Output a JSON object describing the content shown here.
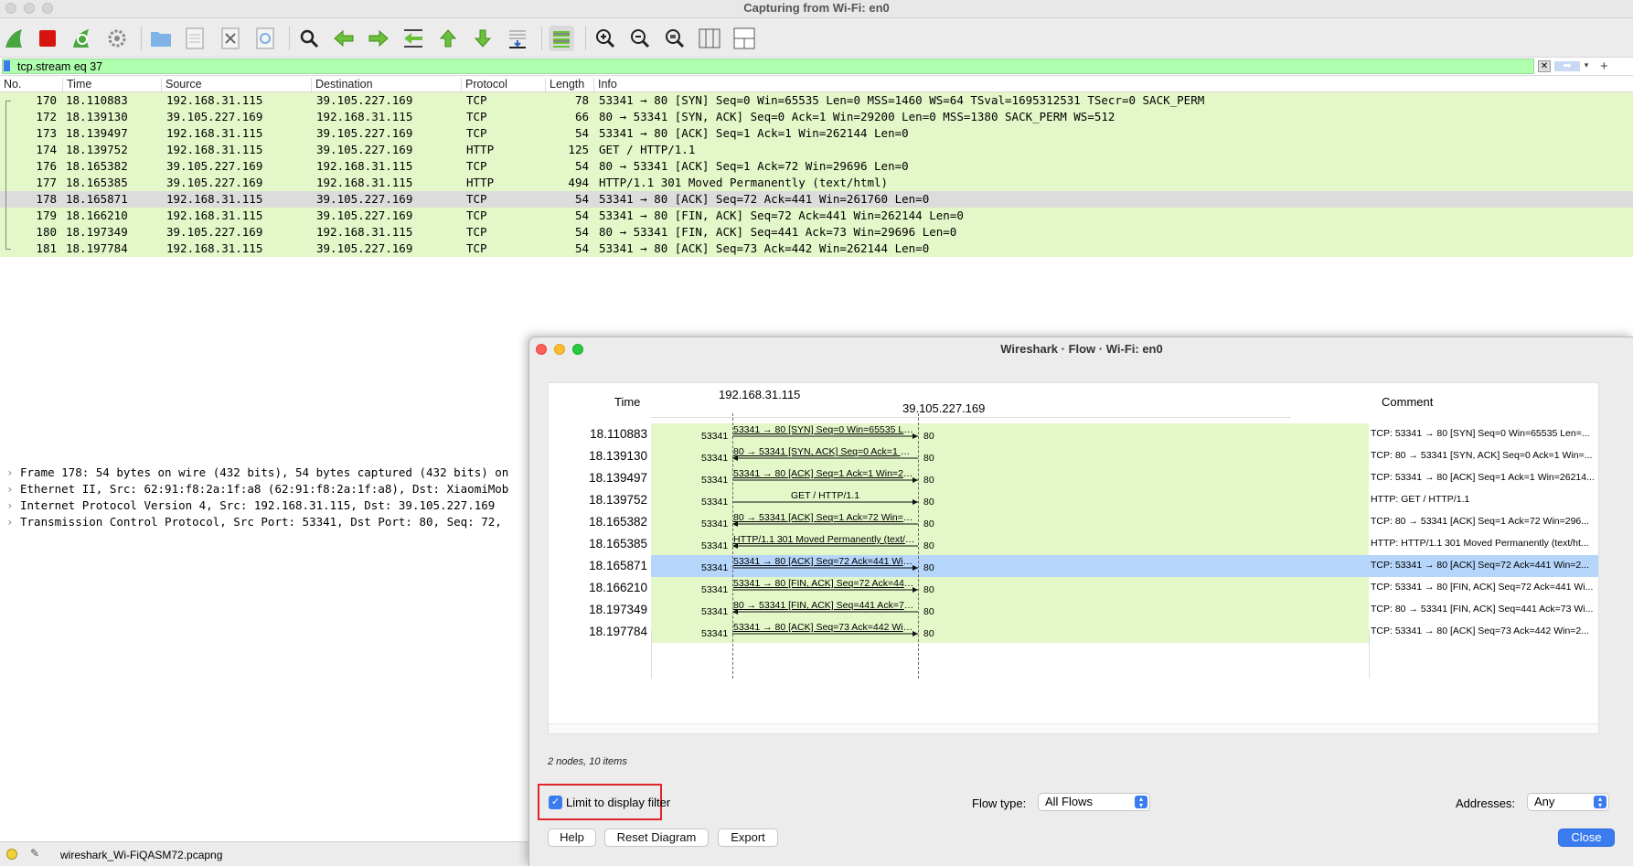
{
  "main_window": {
    "title": "Capturing from Wi-Fi: en0",
    "toolbar": [
      "shark-fin-icon",
      "stop-icon",
      "restart-icon",
      "gear-icon",
      "open-folder-icon",
      "save-file-icon",
      "close-file-icon",
      "reload-icon",
      "search-icon",
      "back-arrow-icon",
      "forward-arrow-icon",
      "goto-packet-icon",
      "first-packet-icon",
      "last-packet-icon",
      "autoscroll-icon",
      "colorize-icon",
      "zoom-in-icon",
      "zoom-out-icon",
      "zoom-reset-icon",
      "resize-columns-icon",
      "layout-icon"
    ],
    "filter": {
      "value": "tcp.stream eq 37",
      "add_label": "+"
    },
    "columns": [
      "No.",
      "Time",
      "Source",
      "Destination",
      "Protocol",
      "Length",
      "Info"
    ],
    "packets": [
      {
        "no": "170",
        "time": "18.110883",
        "src": "192.168.31.115",
        "dst": "39.105.227.169",
        "proto": "TCP",
        "len": "78",
        "info": "53341 → 80 [SYN] Seq=0 Win=65535 Len=0 MSS=1460 WS=64 TSval=1695312531 TSecr=0 SACK_PERM"
      },
      {
        "no": "172",
        "time": "18.139130",
        "src": "39.105.227.169",
        "dst": "192.168.31.115",
        "proto": "TCP",
        "len": "66",
        "info": "80 → 53341 [SYN, ACK] Seq=0 Ack=1 Win=29200 Len=0 MSS=1380 SACK_PERM WS=512"
      },
      {
        "no": "173",
        "time": "18.139497",
        "src": "192.168.31.115",
        "dst": "39.105.227.169",
        "proto": "TCP",
        "len": "54",
        "info": "53341 → 80 [ACK] Seq=1 Ack=1 Win=262144 Len=0"
      },
      {
        "no": "174",
        "time": "18.139752",
        "src": "192.168.31.115",
        "dst": "39.105.227.169",
        "proto": "HTTP",
        "len": "125",
        "info": "GET / HTTP/1.1"
      },
      {
        "no": "176",
        "time": "18.165382",
        "src": "39.105.227.169",
        "dst": "192.168.31.115",
        "proto": "TCP",
        "len": "54",
        "info": "80 → 53341 [ACK] Seq=1 Ack=72 Win=29696 Len=0"
      },
      {
        "no": "177",
        "time": "18.165385",
        "src": "39.105.227.169",
        "dst": "192.168.31.115",
        "proto": "HTTP",
        "len": "494",
        "info": "HTTP/1.1 301 Moved Permanently  (text/html)"
      },
      {
        "no": "178",
        "time": "18.165871",
        "src": "192.168.31.115",
        "dst": "39.105.227.169",
        "proto": "TCP",
        "len": "54",
        "info": "53341 → 80 [ACK] Seq=72 Ack=441 Win=261760 Len=0"
      },
      {
        "no": "179",
        "time": "18.166210",
        "src": "192.168.31.115",
        "dst": "39.105.227.169",
        "proto": "TCP",
        "len": "54",
        "info": "53341 → 80 [FIN, ACK] Seq=72 Ack=441 Win=262144 Len=0"
      },
      {
        "no": "180",
        "time": "18.197349",
        "src": "39.105.227.169",
        "dst": "192.168.31.115",
        "proto": "TCP",
        "len": "54",
        "info": "80 → 53341 [FIN, ACK] Seq=441 Ack=73 Win=29696 Len=0"
      },
      {
        "no": "181",
        "time": "18.197784",
        "src": "192.168.31.115",
        "dst": "39.105.227.169",
        "proto": "TCP",
        "len": "54",
        "info": "53341 → 80 [ACK] Seq=73 Ack=442 Win=262144 Len=0"
      }
    ],
    "selected_packet": "178",
    "details": [
      "Frame 178: 54 bytes on wire (432 bits), 54 bytes captured (432 bits) on",
      "Ethernet II, Src: 62:91:f8:2a:1f:a8 (62:91:f8:2a:1f:a8), Dst: XiaomiMob",
      "Internet Protocol Version 4, Src: 192.168.31.115, Dst: 39.105.227.169",
      "Transmission Control Protocol, Src Port: 53341, Dst Port: 80, Seq: 72,"
    ],
    "status_file": "wireshark_Wi-FiQASM72.pcapng"
  },
  "flow_dialog": {
    "title": "Wireshark · Flow · Wi-Fi: en0",
    "col_time": "Time",
    "col_comment": "Comment",
    "node_a": "192.168.31.115",
    "node_b": "39.105.227.169",
    "items": [
      {
        "time": "18.110883",
        "label": "53341 → 80 [SYN] Seq=0 Win=65535 Len=0...",
        "dir": "right",
        "src_port": "53341",
        "dst_port": "80",
        "comment": "TCP: 53341 → 80 [SYN] Seq=0 Win=65535 Len=..."
      },
      {
        "time": "18.139130",
        "label": "80 → 53341 [SYN, ACK] Seq=0 Ack=1 Win=2...",
        "dir": "left",
        "src_port": "53341",
        "dst_port": "80",
        "comment": "TCP: 80 → 53341 [SYN, ACK] Seq=0 Ack=1 Win=..."
      },
      {
        "time": "18.139497",
        "label": "53341 → 80 [ACK] Seq=1 Ack=1 Win=262144...",
        "dir": "right",
        "src_port": "53341",
        "dst_port": "80",
        "comment": "TCP: 53341 → 80 [ACK] Seq=1 Ack=1 Win=26214..."
      },
      {
        "time": "18.139752",
        "label": "GET / HTTP/1.1",
        "dir": "right",
        "src_port": "53341",
        "dst_port": "80",
        "comment": "HTTP: GET / HTTP/1.1"
      },
      {
        "time": "18.165382",
        "label": "80 → 53341 [ACK] Seq=1 Ack=72 Win=2969...",
        "dir": "left",
        "src_port": "53341",
        "dst_port": "80",
        "comment": "TCP: 80 → 53341 [ACK] Seq=1 Ack=72 Win=296..."
      },
      {
        "time": "18.165385",
        "label": "HTTP/1.1 301 Moved Permanently  (text/html)",
        "dir": "left",
        "src_port": "53341",
        "dst_port": "80",
        "comment": "HTTP: HTTP/1.1 301 Moved Permanently  (text/ht..."
      },
      {
        "time": "18.165871",
        "label": "53341 → 80 [ACK] Seq=72 Ack=441 Win=26...",
        "dir": "right",
        "src_port": "53341",
        "dst_port": "80",
        "comment": "TCP: 53341 → 80 [ACK] Seq=72 Ack=441 Win=2..."
      },
      {
        "time": "18.166210",
        "label": "53341 → 80 [FIN, ACK] Seq=72 Ack=441 Win...",
        "dir": "right",
        "src_port": "53341",
        "dst_port": "80",
        "comment": "TCP: 53341 → 80 [FIN, ACK] Seq=72 Ack=441 Wi..."
      },
      {
        "time": "18.197349",
        "label": "80 → 53341 [FIN, ACK] Seq=441 Ack=73 Win...",
        "dir": "left",
        "src_port": "53341",
        "dst_port": "80",
        "comment": "TCP: 80 → 53341 [FIN, ACK] Seq=441 Ack=73 Wi..."
      },
      {
        "time": "18.197784",
        "label": "53341 → 80 [ACK] Seq=73 Ack=442 Win=26...",
        "dir": "right",
        "src_port": "53341",
        "dst_port": "80",
        "comment": "TCP: 53341 → 80 [ACK] Seq=73 Ack=442 Win=2..."
      }
    ],
    "selected_index": 6,
    "summary": "2 nodes, 10 items",
    "limit_label": "Limit to display filter",
    "limit_checked": true,
    "flow_type_label": "Flow type:",
    "flow_type_value": "All Flows",
    "addresses_label": "Addresses:",
    "addresses_value": "Any",
    "buttons": {
      "help": "Help",
      "reset": "Reset Diagram",
      "export": "Export",
      "close": "Close"
    }
  },
  "colors": {
    "tcp_row": "#e4f7c8",
    "selected_row": "#dcdcdc",
    "flow_selected": "#b5d5fb",
    "filter_ok": "#afffaf",
    "accent": "#3a7cf0",
    "highlight_box": "#e0262b"
  }
}
